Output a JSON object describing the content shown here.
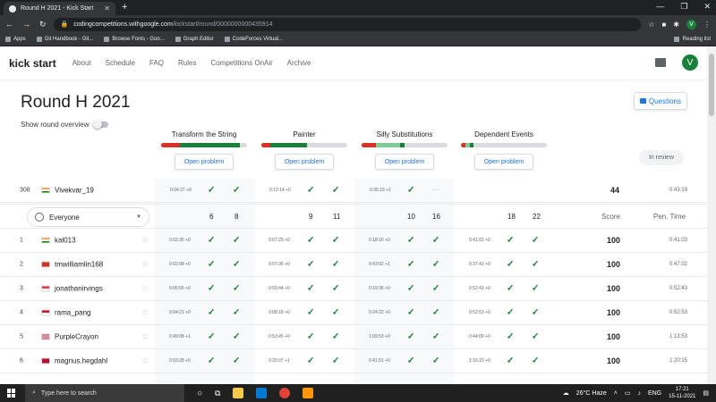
{
  "browser": {
    "tab_title": "Round H 2021 - Kick Start",
    "url_host": "codingcompetitions.withgoogle.com",
    "url_path": "/kickstart/round/0000000000435914",
    "profile_initial": "V",
    "bookmarks": [
      "Apps",
      "Git Handbook - Git...",
      "Browse Fonts - Goo...",
      "Graph Editor",
      "CodeForces Virtual..."
    ],
    "reading_list": "Reading list"
  },
  "site": {
    "brand": "kick start",
    "nav": [
      "About",
      "Schedule",
      "FAQ",
      "Rules",
      "Competitions OnAir",
      "Archive"
    ],
    "avatar_initial": "V"
  },
  "round": {
    "title": "Round H 2021",
    "overview_label": "Show round overview",
    "questions_label": "Questions",
    "in_review": "In review",
    "open_label": "Open problem",
    "problems": [
      {
        "name": "Transform the String",
        "red": 0.22,
        "green": 0.7,
        "light": 0.0
      },
      {
        "name": "Painter",
        "red": 0.1,
        "green": 0.43,
        "light": 0.0
      },
      {
        "name": "Silly Substitutions",
        "red": 0.17,
        "green": 0.05,
        "light": 0.28
      },
      {
        "name": "Dependent Events",
        "red": 0.05,
        "green": 0.05,
        "light": 0.05
      }
    ]
  },
  "my_row": {
    "rank": "308",
    "name": "Vivekvar_19",
    "times": [
      "0:04:27 +0",
      "0:12:14 +0",
      "0:35:19 +2",
      ""
    ],
    "score": "44",
    "penalty": "0:43:19",
    "marks": [
      [
        "ok",
        "ok"
      ],
      [
        "ok",
        "ok"
      ],
      [
        "ok",
        "dash"
      ],
      [
        "",
        ""
      ]
    ]
  },
  "header_row": {
    "filter": "Everyone",
    "counts": [
      "6",
      "8",
      "9",
      "11",
      "10",
      "16",
      "18",
      "22"
    ],
    "score_label": "Score",
    "penalty_label": "Pen. Time"
  },
  "rows": [
    {
      "rank": "1",
      "name": "kal013",
      "flag": "in",
      "times": [
        "0:02:35 +0",
        "0:07:29 +0",
        "0:18:16 +0",
        "0:41:03 +0"
      ],
      "score": "100",
      "penalty": "0:41:03"
    },
    {
      "rank": "2",
      "name": "tmwilliamlin168",
      "flag": "tw",
      "times": [
        "0:02:08 +0",
        "0:07:36 +0",
        "0:43:02 +1",
        "0:37:43 +0"
      ],
      "score": "100",
      "penalty": "0:47:02"
    },
    {
      "rank": "3",
      "name": "jonathanirvings",
      "flag": "sg",
      "times": [
        "0:05:55 +0",
        "0:03:44 +0",
        "0:19:36 +0",
        "0:52:43 +0"
      ],
      "score": "100",
      "penalty": "0:52:43"
    },
    {
      "rank": "4",
      "name": "rama_pang",
      "flag": "id",
      "times": [
        "0:04:21 +0",
        "0:08:18 +0",
        "0:24:22 +0",
        "0:52:53 +0"
      ],
      "score": "100",
      "penalty": "0:52:53"
    },
    {
      "rank": "5",
      "name": "PurpleCrayon",
      "flag": "us",
      "times": [
        "0:49:08 +1",
        "0:53:45 +0",
        "1:09:53 +0",
        "0:44:09 +0"
      ],
      "score": "100",
      "penalty": "1:13:53"
    },
    {
      "rank": "6",
      "name": "magnus.hegdahl",
      "flag": "no",
      "times": [
        "0:03:28 +0",
        "0:20:37 +1",
        "0:41:51 +0",
        "1:16:15 +0"
      ],
      "score": "100",
      "penalty": "1:20:15"
    }
  ],
  "taskbar": {
    "search_placeholder": "Type here to search",
    "weather": "26°C Haze",
    "lang": "ENG",
    "time": "17:21",
    "date": "15-11-2021"
  },
  "colors": {
    "accent": "#1a73e8",
    "green": "#188038",
    "red": "#d93025"
  }
}
